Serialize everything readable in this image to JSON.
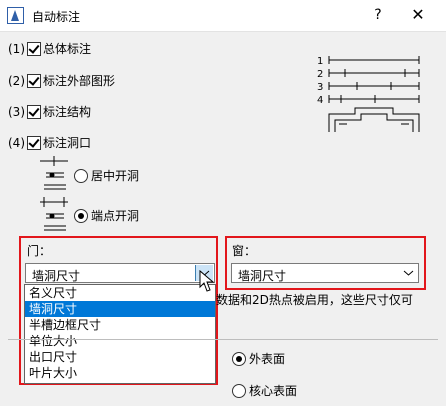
{
  "window": {
    "title": "自动标注",
    "help_label": "?",
    "close_label": "✕"
  },
  "options": [
    {
      "num": "(1)",
      "label": "总体标注",
      "checked": true
    },
    {
      "num": "(2)",
      "label": "标注外部图形",
      "checked": true
    },
    {
      "num": "(3)",
      "label": "标注结构",
      "checked": true
    },
    {
      "num": "(4)",
      "label": "标注洞口",
      "checked": true
    }
  ],
  "preview_numbers": [
    "1",
    "2",
    "3",
    "4"
  ],
  "opening": {
    "center_label": "居中开洞",
    "edge_label": "端点开洞",
    "selected": "端点开洞"
  },
  "door": {
    "label": "门：",
    "value": "墙洞尺寸",
    "options": [
      "名义尺寸",
      "墙洞尺寸",
      "半槽边框尺寸",
      "单位大小",
      "出口尺寸",
      "叶片大小"
    ],
    "selected_index": 1
  },
  "window_dim": {
    "label": "窗：",
    "value": "墙洞尺寸"
  },
  "note_text": "数据和2D热点被启用，这些尺寸仅可",
  "surface": {
    "outer_label": "外表面",
    "core_label": "核心表面",
    "selected": "外表面"
  }
}
